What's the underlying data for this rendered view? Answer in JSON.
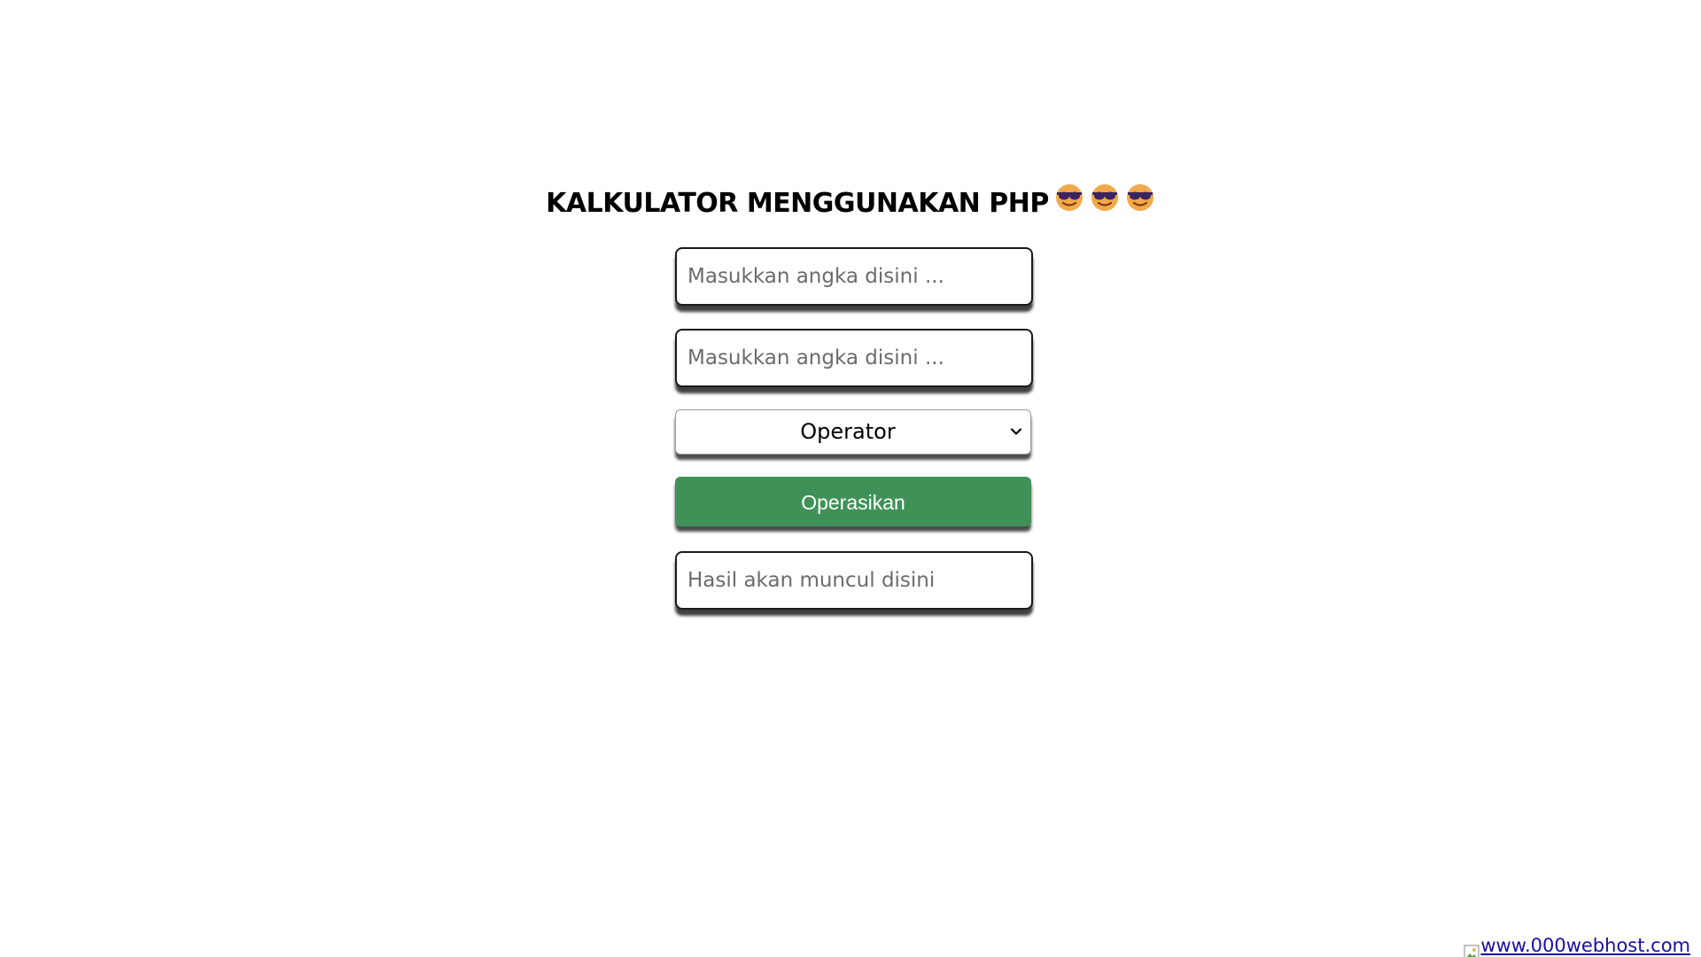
{
  "page": {
    "title": "KALKULATOR MENGGUNAKAN PHP",
    "title_emoji": "smiling-face-with-sunglasses-icon",
    "title_emoji_count": 3
  },
  "form": {
    "first_number": {
      "placeholder": "Masukkan angka disini ...",
      "value": ""
    },
    "second_number": {
      "placeholder": "Masukkan angka disini ...",
      "value": ""
    },
    "operator": {
      "selected": "Operator"
    },
    "submit_label": "Operasikan",
    "result": {
      "placeholder": "Hasil akan muncul disini",
      "value": ""
    }
  },
  "footer": {
    "link_text": "www.000webhost.com",
    "image_icon": "broken-image-icon"
  },
  "colors": {
    "button_bg": "#3f9158",
    "button_text": "#ffffff",
    "link": "#1a0dab",
    "border": "#1a1a1a"
  }
}
